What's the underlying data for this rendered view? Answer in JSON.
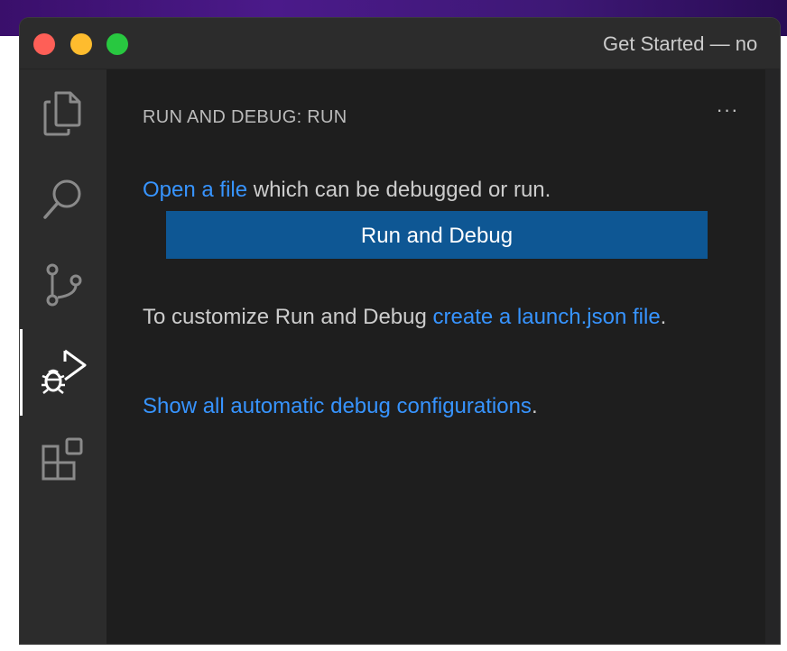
{
  "window": {
    "title": "Get Started — no"
  },
  "activity_bar": {
    "items": [
      {
        "icon": "files-icon",
        "name": "explorer"
      },
      {
        "icon": "search-icon",
        "name": "search"
      },
      {
        "icon": "source-control-icon",
        "name": "source-control"
      },
      {
        "icon": "run-debug-icon",
        "name": "run-and-debug",
        "active": true
      },
      {
        "icon": "extensions-icon",
        "name": "extensions"
      }
    ]
  },
  "sidebar": {
    "title": "RUN AND DEBUG: RUN",
    "more_actions": "···",
    "intro": {
      "link_text": "Open a file",
      "rest_text": " which can be debugged or run."
    },
    "run_button_label": "Run and Debug",
    "customize": {
      "prefix_text": "To customize Run and Debug ",
      "link_text": "create a launch.json file",
      "suffix_text": "."
    },
    "show_all": {
      "link_text": "Show all automatic debug configurations",
      "suffix_text": "."
    }
  },
  "colors": {
    "accent_link": "#3794ff",
    "button_bg": "#0e5794",
    "close": "#fe5f57",
    "minimize": "#febc2e",
    "maximize": "#28c840"
  }
}
